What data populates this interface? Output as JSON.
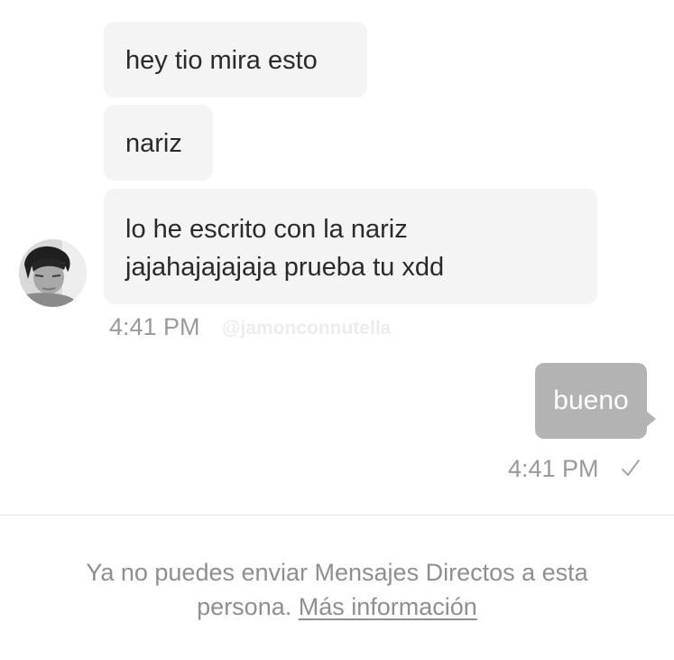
{
  "conversation": {
    "incoming": [
      {
        "lines": [
          "hey tio mira esto"
        ]
      },
      {
        "lines": [
          "nariz"
        ]
      },
      {
        "lines": [
          "lo he escrito con la nariz",
          "jajahajajajaja prueba tu xdd"
        ]
      }
    ],
    "incoming_time": "4:41 PM",
    "watermark": "@jamonconnutella",
    "outgoing": {
      "text": "bueno",
      "time": "4:41 PM"
    }
  },
  "footer": {
    "notice": "Ya no puedes enviar Mensajes Directos a esta persona.",
    "link": "Más información"
  },
  "icons": {
    "avatar": "contact-avatar",
    "status": "check-icon"
  },
  "colors": {
    "incoming_bubble": "#f4f4f4",
    "outgoing_bubble": "#b3b3b3",
    "muted_text": "#8f8f8f"
  }
}
